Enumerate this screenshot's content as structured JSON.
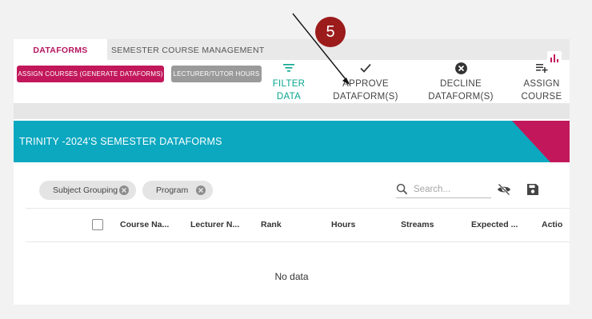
{
  "callout": {
    "number": "5"
  },
  "tabs": [
    {
      "label": "DATAFORMS",
      "active": true
    },
    {
      "label": "SEMESTER COURSE MANAGEMENT",
      "active": false
    }
  ],
  "toolbar": {
    "assign_courses_label": "ASSIGN COURSES (GENERATE DATAFORMS)",
    "lecturer_hours_label": "LECTURER/TUTOR HOURS",
    "filter": {
      "line1": "FILTER",
      "line2": "DATA",
      "icon": "filter-icon"
    },
    "approve": {
      "line1": "APPROVE",
      "line2": "DATAFORM(S)",
      "icon": "check-icon"
    },
    "decline": {
      "line1": "DECLINE",
      "line2": "DATAFORM(S)",
      "icon": "cancel-circle-icon"
    },
    "assign": {
      "line1": "ASSIGN",
      "line2": "COURSE",
      "icon": "playlist-add-icon"
    }
  },
  "header": {
    "title": "TRINITY -2024'S SEMESTER DATAFORMS",
    "icon": "bar-chart-icon"
  },
  "filters": {
    "chips": [
      {
        "label": "Subject Grouping"
      },
      {
        "label": "Program"
      }
    ],
    "search_placeholder": "Search..."
  },
  "table": {
    "columns": [
      "Course Na...",
      "Lecturer N...",
      "Rank",
      "Hours",
      "Streams",
      "Expected ...",
      "Actio"
    ],
    "empty_text": "No data"
  },
  "colors": {
    "brand": "#c2185b",
    "accent_teal": "#0ba8c0",
    "filter_green": "#0aa58f",
    "callout_red": "#9c1b1b"
  }
}
